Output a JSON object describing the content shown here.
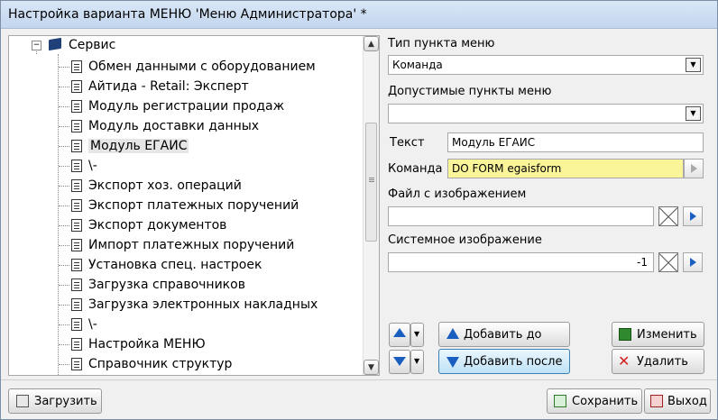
{
  "window": {
    "title": "Настройка варианта МЕНЮ 'Меню Администратора' *"
  },
  "tree": {
    "root": {
      "label": "Сервис",
      "expander": "−"
    },
    "items": [
      {
        "label": "Обмен данными с оборудованием"
      },
      {
        "label": "Айтида - Retail: Эксперт"
      },
      {
        "label": "Модуль регистрации продаж"
      },
      {
        "label": "Модуль доставки данных"
      },
      {
        "label": "Модуль ЕГАИС",
        "selected": true
      },
      {
        "label": "\\-"
      },
      {
        "label": "Экспорт хоз. операций"
      },
      {
        "label": "Экспорт платежных поручений"
      },
      {
        "label": "Экспорт документов"
      },
      {
        "label": "Импорт платежных поручений"
      },
      {
        "label": "Установка спец. настроек"
      },
      {
        "label": "Загрузка справочников"
      },
      {
        "label": "Загрузка электронных накладных"
      },
      {
        "label": "\\-"
      },
      {
        "label": "Настройка МЕНЮ"
      },
      {
        "label": "Справочник структур"
      }
    ]
  },
  "form": {
    "menu_type_label": "Тип пункта меню",
    "menu_type_value": "Команда",
    "allowed_label": "Допустимые пункты меню",
    "allowed_value": "",
    "text_label": "Текст",
    "text_value": "Модуль ЕГАИС",
    "command_label": "Команда",
    "command_value": "DO FORM egaisform",
    "image_file_label": "Файл с изображением",
    "image_file_value": "",
    "system_image_label": "Системное изображение",
    "system_image_value": "-1"
  },
  "buttons": {
    "add_before": "Добавить до",
    "add_after": "Добавить после",
    "edit": "Изменить",
    "delete": "Удалить",
    "load": "Загрузить",
    "save": "Сохранить",
    "exit": "Выход"
  },
  "colors": {
    "command_highlight": "#fbf59a",
    "arrow_blue": "#1a5fc0",
    "delete_red": "#d42020"
  }
}
